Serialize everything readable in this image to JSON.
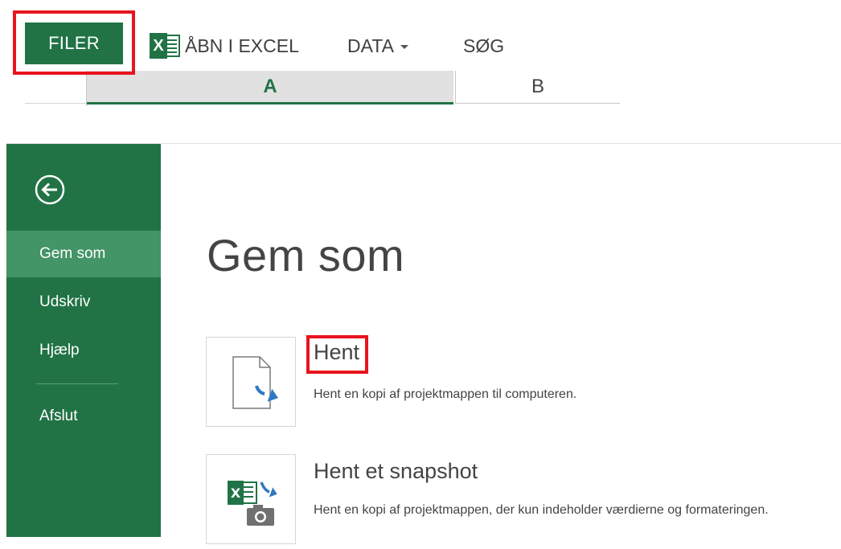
{
  "ribbon": {
    "file_tab": "FILER",
    "menu": {
      "open_excel": "ÅBN I EXCEL",
      "data": "DATA",
      "search": "SØG"
    },
    "columns": [
      "A",
      "B"
    ],
    "excel_icon_letter": "X"
  },
  "backstage": {
    "sidebar": {
      "items": [
        {
          "label": "Gem som",
          "active": true
        },
        {
          "label": "Udskriv"
        },
        {
          "label": "Hjælp"
        },
        {
          "label": "Afslut"
        }
      ]
    },
    "title": "Gem som",
    "options": [
      {
        "title": "Hent",
        "description": "Hent en kopi af projektmappen til computeren.",
        "icon": "download-document-icon"
      },
      {
        "title": "Hent et snapshot",
        "description": "Hent en kopi af projektmappen, der kun indeholder værdierne og formateringen.",
        "icon": "excel-snapshot-icon"
      }
    ]
  },
  "colors": {
    "excel_green": "#217346",
    "active_nav": "#439467",
    "highlight_red": "#e8141e"
  }
}
